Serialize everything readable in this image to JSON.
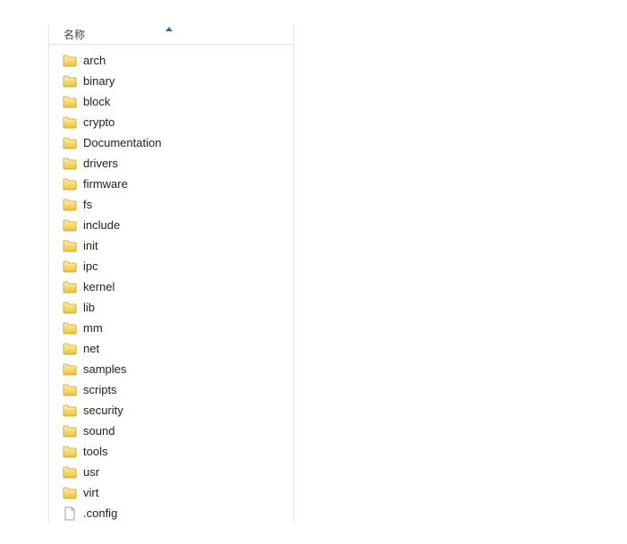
{
  "header": {
    "name_column": "名称"
  },
  "items": [
    {
      "type": "folder",
      "name": "arch"
    },
    {
      "type": "folder",
      "name": "binary"
    },
    {
      "type": "folder",
      "name": "block"
    },
    {
      "type": "folder",
      "name": "crypto"
    },
    {
      "type": "folder",
      "name": "Documentation"
    },
    {
      "type": "folder",
      "name": "drivers"
    },
    {
      "type": "folder",
      "name": "firmware"
    },
    {
      "type": "folder",
      "name": "fs"
    },
    {
      "type": "folder",
      "name": "include"
    },
    {
      "type": "folder",
      "name": "init"
    },
    {
      "type": "folder",
      "name": "ipc"
    },
    {
      "type": "folder",
      "name": "kernel"
    },
    {
      "type": "folder",
      "name": "lib"
    },
    {
      "type": "folder",
      "name": "mm"
    },
    {
      "type": "folder",
      "name": "net"
    },
    {
      "type": "folder",
      "name": "samples"
    },
    {
      "type": "folder",
      "name": "scripts"
    },
    {
      "type": "folder",
      "name": "security"
    },
    {
      "type": "folder",
      "name": "sound"
    },
    {
      "type": "folder",
      "name": "tools"
    },
    {
      "type": "folder",
      "name": "usr"
    },
    {
      "type": "folder",
      "name": "virt"
    },
    {
      "type": "file",
      "name": ".config"
    }
  ]
}
